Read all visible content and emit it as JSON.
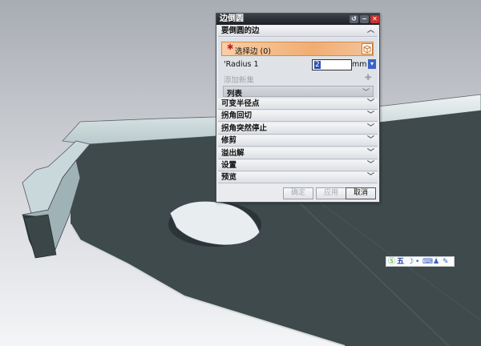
{
  "dialog": {
    "title": "边倒圆",
    "reset_icon": "reset-icon",
    "minimize_icon": "minimize-icon",
    "close_icon": "close-icon",
    "edge_section": {
      "header": "要倒圆的边",
      "select_edge_label": "选择边 (0)",
      "radius_label": "'Radius 1",
      "radius_value": "2",
      "radius_unit": "mm",
      "add_new_set_label": "添加新集",
      "list_label": "列表"
    },
    "sections": [
      "可变半径点",
      "拐角回切",
      "拐角突然停止",
      "修剪",
      "溢出解",
      "设置",
      "预览"
    ],
    "buttons": {
      "ok": "确定",
      "apply": "应用",
      "cancel": "取消"
    }
  },
  "ime_toolbar": {
    "mode_label": "五"
  },
  "colors": {
    "selection_highlight": "#f1ad72",
    "title_bar": "#2a2d33",
    "part_body": "#3f4b4d",
    "background_top": "#a9adb4",
    "background_bottom": "#f2f3f5"
  }
}
